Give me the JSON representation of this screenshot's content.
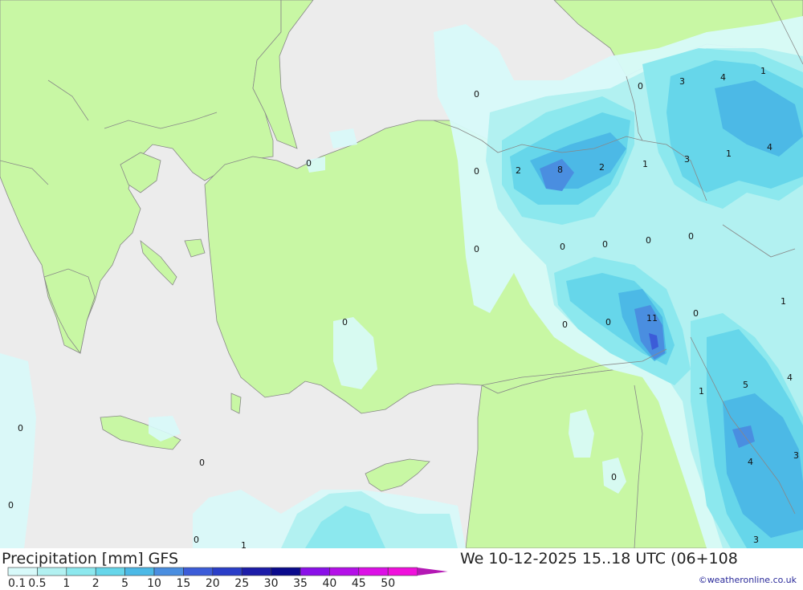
{
  "title": "Precipitation [mm] GFS",
  "valid_time": "We 10-12-2025 15..18 UTC (06+108",
  "credit": "©weatheronline.co.uk",
  "colors": {
    "sea": "#ececec",
    "land": "#c8f7a4",
    "border": "#888888",
    "p01": "#d8fafa",
    "p05": "#b2f1f1",
    "p1": "#8ce8ee",
    "p2": "#66d6ea",
    "p5": "#4cb9e6",
    "p10": "#4a8ee0",
    "p15": "#3c5cd8"
  },
  "legend": {
    "labels": [
      "0.1",
      "0.5",
      "1",
      "2",
      "5",
      "10",
      "15",
      "20",
      "25",
      "30",
      "35",
      "40",
      "45",
      "50"
    ],
    "colors": [
      "#d8fafa",
      "#b2f1f1",
      "#8ce8ee",
      "#66d6ea",
      "#4cb9e6",
      "#4a8ee0",
      "#3c5cd8",
      "#2a3ec8",
      "#1c1ca8",
      "#0a0a8c",
      "#8a10e8",
      "#b410e8",
      "#dc10e6",
      "#f010dc",
      "#b418b4"
    ]
  },
  "value_labels": [
    "0",
    "2",
    "8",
    "2",
    "1",
    "3",
    "4",
    "1",
    "0",
    "3",
    "1",
    "4",
    "0",
    "0",
    "0",
    "0",
    "0",
    "0",
    "0",
    "11",
    "0",
    "0",
    "1",
    "4",
    "5",
    "4",
    "3",
    "1",
    "0",
    "0",
    "0",
    "0",
    "0",
    "0",
    "0",
    "1",
    "3"
  ]
}
